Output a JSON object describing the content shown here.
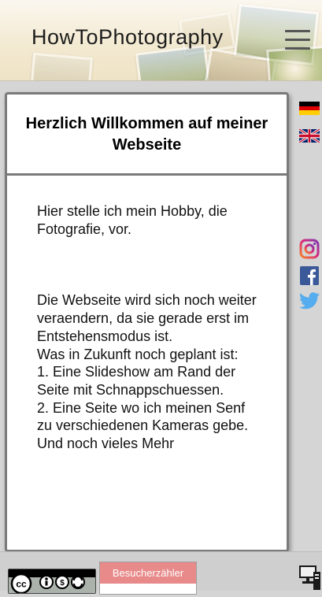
{
  "header": {
    "site_title": "HowToPhotography",
    "menu_icon": "hamburger-menu-icon"
  },
  "main": {
    "title": "Herzlich Willkommen auf meiner Webseite",
    "intro": "Hier stelle ich mein Hobby, die Fotografie, vor.",
    "body_lines": [
      "Die Webseite wird sich noch weiter veraendern, da sie gerade erst im Entstehensmodus ist.",
      "Was in Zukunft noch geplant ist:",
      "1. Eine Slideshow am Rand der Seite mit Schnappschuessen.",
      "2. Eine Seite wo ich meinen Senf zu verschiedenen Kameras gebe.",
      "Und noch vieles Mehr"
    ]
  },
  "sidebar": {
    "languages": [
      {
        "name": "de-flag-icon",
        "colors": [
          "#000000",
          "#dd0000",
          "#ffce00"
        ]
      },
      {
        "name": "uk-flag-icon",
        "colors": [
          "#012169",
          "#ffffff",
          "#c8102e"
        ]
      }
    ],
    "social": [
      {
        "name": "instagram-icon",
        "color": "#c13584"
      },
      {
        "name": "facebook-icon",
        "color": "#3b5998"
      },
      {
        "name": "twitter-icon",
        "color": "#55acee"
      }
    ]
  },
  "footer": {
    "license_icon": "creative-commons-badge-icon",
    "counter_label": "Besucherzähler",
    "counter_color": "#e88a8a",
    "device_icon": "computer-icon"
  }
}
